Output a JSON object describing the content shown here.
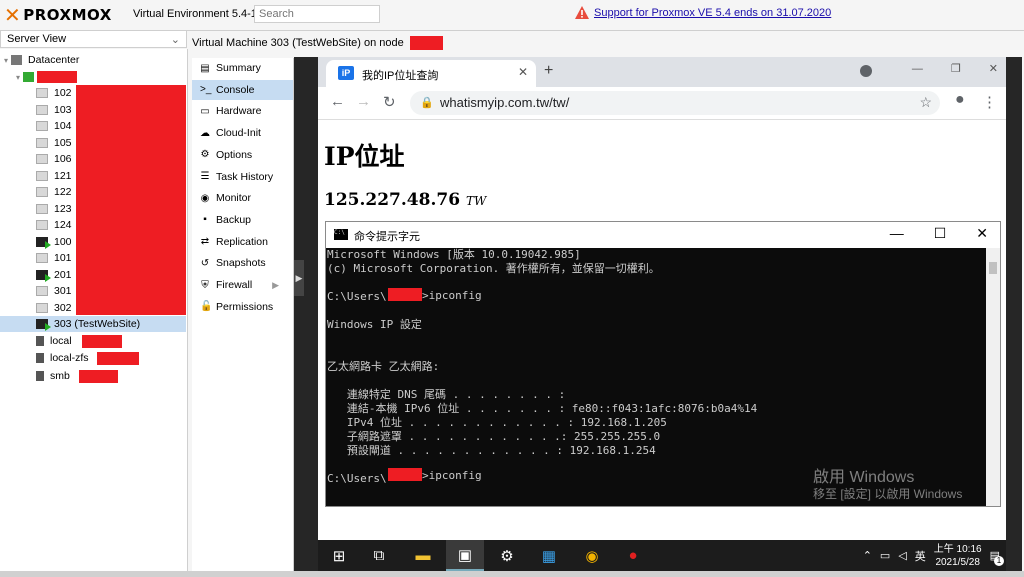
{
  "header": {
    "logo_text": "PROXMOX",
    "version": "Virtual Environment 5.4-15",
    "search_placeholder": "Search",
    "support_link": "Support for Proxmox VE 5.4 ends on 31.07.2020"
  },
  "server_view": {
    "label": "Server View",
    "datacenter": "Datacenter",
    "vms": [
      {
        "id": "102",
        "state": "stopped"
      },
      {
        "id": "103",
        "state": "stopped"
      },
      {
        "id": "104",
        "state": "stopped"
      },
      {
        "id": "105",
        "state": "stopped"
      },
      {
        "id": "106",
        "state": "stopped"
      },
      {
        "id": "121",
        "state": "stopped"
      },
      {
        "id": "122",
        "state": "stopped"
      },
      {
        "id": "123",
        "state": "stopped"
      },
      {
        "id": "124",
        "state": "stopped"
      },
      {
        "id": "100",
        "state": "running"
      },
      {
        "id": "101",
        "state": "stopped"
      },
      {
        "id": "201",
        "state": "running"
      },
      {
        "id": "301",
        "state": "stopped"
      },
      {
        "id": "302",
        "state": "stopped"
      },
      {
        "id": "303 (TestWebSite)",
        "state": "running",
        "selected": true
      }
    ],
    "storage": [
      "local",
      "local-zfs",
      "smb"
    ]
  },
  "vm_header": {
    "title": "Virtual Machine 303 (TestWebSite) on node"
  },
  "menu": [
    {
      "label": "Summary",
      "icon": "summary-icon"
    },
    {
      "label": "Console",
      "icon": "console-icon",
      "active": true
    },
    {
      "label": "Hardware",
      "icon": "hardware-icon"
    },
    {
      "label": "Cloud-Init",
      "icon": "cloud-icon"
    },
    {
      "label": "Options",
      "icon": "gear-icon"
    },
    {
      "label": "Task History",
      "icon": "list-icon"
    },
    {
      "label": "Monitor",
      "icon": "eye-icon"
    },
    {
      "label": "Backup",
      "icon": "floppy-icon"
    },
    {
      "label": "Replication",
      "icon": "retweet-icon"
    },
    {
      "label": "Snapshots",
      "icon": "history-icon"
    },
    {
      "label": "Firewall",
      "icon": "shield-icon",
      "has_submenu": true
    },
    {
      "label": "Permissions",
      "icon": "unlock-icon"
    }
  ],
  "browser": {
    "tab_icon": "iP",
    "tab_title": "我的IP位址查詢",
    "url": "whatismyip.com.tw/tw/",
    "heading": "IP位址",
    "ip": "125.227.48.76",
    "country": "TW"
  },
  "cmd": {
    "title": "命令提示字元",
    "icon_text": "C:\\",
    "lines": [
      "Microsoft Windows [版本 10.0.19042.985]",
      "(c) Microsoft Corporation. 著作權所有，並保留一切權利。",
      "",
      "C:\\Users\\",
      "",
      "Windows IP 設定",
      "",
      "",
      "乙太網路卡 乙太網路:",
      "",
      "   連線特定 DNS 尾碼 . . . . . . . . :",
      "   連結-本機 IPv6 位址 . . . . . . . : fe80::f043:1afc:8076:b0a4%14",
      "   IPv4 位址 . . . . . . . . . . . . : 192.168.1.205",
      "   子網路遮罩 . . . . . . . . . . . .: 255.255.255.0",
      "   預設閘道 . . . . . . . . . . . . : 192.168.1.254",
      "",
      "C:\\Users\\"
    ],
    "prompt_cmd": ">ipconfig"
  },
  "watermark": {
    "line1": "啟用 Windows",
    "line2": "移至 [設定] 以啟用 Windows"
  },
  "taskbar": {
    "time": "上午 10:16",
    "date": "2021/5/28",
    "ime": "英",
    "notifications": "1"
  }
}
